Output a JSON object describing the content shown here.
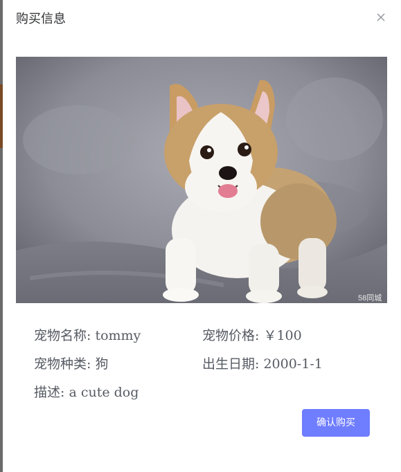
{
  "dialog": {
    "title": "购买信息",
    "close_icon": "close-icon",
    "photo": {
      "description_icon": "corgi-puppy-photo",
      "watermark": "58同城"
    }
  },
  "pet": {
    "name_label": "宠物名称:",
    "name_value": "tommy",
    "price_label": "宠物价格:",
    "price_value": "￥100",
    "type_label": "宠物种类:",
    "type_value": "狗",
    "birth_label": "出生日期:",
    "birth_value": "2000-1-1",
    "desc_label": "描述:",
    "desc_value": "a cute dog"
  },
  "actions": {
    "confirm_label": "确认购买"
  },
  "colors": {
    "primary": "#6f7dff",
    "text": "#555a62",
    "title": "#303133"
  }
}
